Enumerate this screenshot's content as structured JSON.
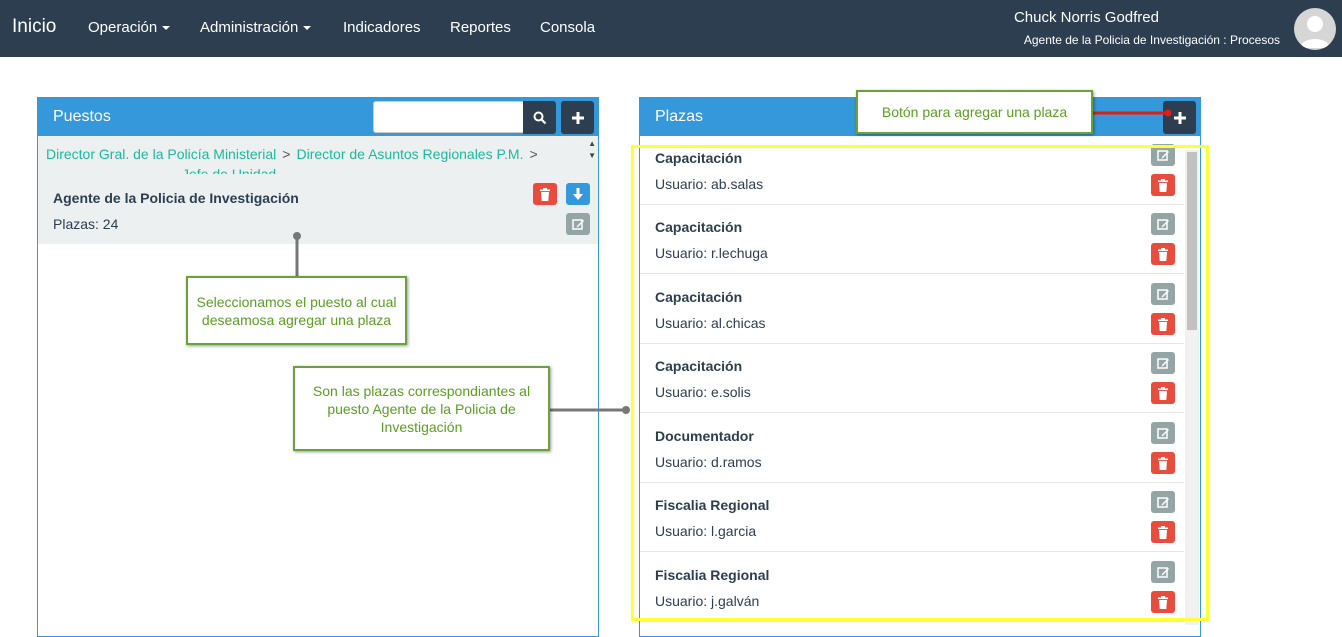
{
  "navbar": {
    "brand": "Inicio",
    "items": [
      {
        "label": "Operación",
        "dropdown": true
      },
      {
        "label": "Administración",
        "dropdown": true
      },
      {
        "label": "Indicadores",
        "dropdown": false
      },
      {
        "label": "Reportes",
        "dropdown": false
      },
      {
        "label": "Consola",
        "dropdown": false
      }
    ],
    "user_name": "Chuck Norris Godfred",
    "user_role": "Agente de la Policia de Investigación : Procesos"
  },
  "puestos": {
    "title": "Puestos",
    "search_value": "",
    "breadcrumb": {
      "item1": "Director Gral. de la Policía Ministerial",
      "item2": "Director de Asuntos Regionales P.M.",
      "separator": ">",
      "line2": "Jefe de Unidad"
    },
    "selected": {
      "title": "Agente de la Policia de Investigación",
      "plazas": "Plazas: 24"
    }
  },
  "plazas": {
    "title": "Plazas",
    "rows": [
      {
        "title": "Capacitación",
        "user": "Usuario: ab.salas"
      },
      {
        "title": "Capacitación",
        "user": "Usuario: r.lechuga"
      },
      {
        "title": "Capacitación",
        "user": "Usuario: al.chicas"
      },
      {
        "title": "Capacitación",
        "user": "Usuario: e.solis"
      },
      {
        "title": "Documentador",
        "user": "Usuario: d.ramos"
      },
      {
        "title": "Fiscalia Regional",
        "user": "Usuario: l.garcia"
      },
      {
        "title": "Fiscalia Regional",
        "user": "Usuario: j.galván"
      }
    ]
  },
  "callouts": {
    "add_plaza": "Botón para agregar una plaza",
    "select_puesto": "Seleccionamos el puesto al cual deseamosa agregar una plaza",
    "plazas_info": "Son las plazas correspondiantes al puesto Agente de la Policia de Investigación"
  },
  "colors": {
    "navbar": "#2c3e50",
    "panel_header": "#3498db",
    "breadcrumb_link": "#18bc9c",
    "delete": "#e74c3c",
    "edit": "#95a5a6",
    "highlight": "#ffff33",
    "callout_border": "#6aa23a"
  },
  "icons": [
    "search-icon",
    "plus-icon",
    "trash-icon",
    "arrow-down-icon",
    "edit-icon",
    "user-icon"
  ]
}
